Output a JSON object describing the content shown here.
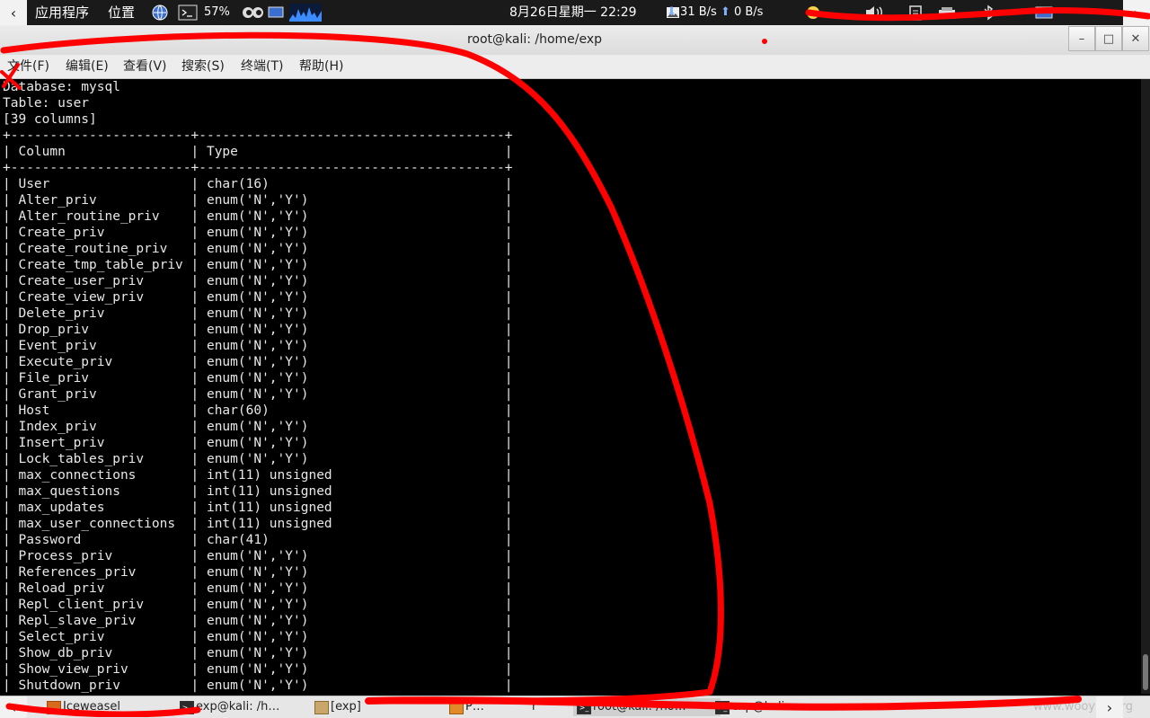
{
  "top_panel": {
    "apps_menu": "应用程序",
    "places_menu": "位置",
    "battery": "57%",
    "clock": "8月26日星期一 22:29",
    "net_down": "31 B/s",
    "net_up": "0 B/s"
  },
  "window": {
    "title": "root@kali: /home/exp",
    "minimize": "–",
    "maximize": "□",
    "close": "✕"
  },
  "menubar": {
    "file": "文件(F)",
    "edit": "编辑(E)",
    "view": "查看(V)",
    "search": "搜索(S)",
    "terminal": "终端(T)",
    "help": "帮助(H)"
  },
  "terminal": {
    "header_lines": [
      "Database: mysql",
      "Table: user",
      "[39 columns]"
    ],
    "border": "+-----------------------+---------------------------------------+",
    "col_headers": [
      "Column",
      "Type"
    ],
    "rows": [
      [
        "User",
        "char(16)"
      ],
      [
        "Alter_priv",
        "enum('N','Y')"
      ],
      [
        "Alter_routine_priv",
        "enum('N','Y')"
      ],
      [
        "Create_priv",
        "enum('N','Y')"
      ],
      [
        "Create_routine_priv",
        "enum('N','Y')"
      ],
      [
        "Create_tmp_table_priv",
        "enum('N','Y')"
      ],
      [
        "Create_user_priv",
        "enum('N','Y')"
      ],
      [
        "Create_view_priv",
        "enum('N','Y')"
      ],
      [
        "Delete_priv",
        "enum('N','Y')"
      ],
      [
        "Drop_priv",
        "enum('N','Y')"
      ],
      [
        "Event_priv",
        "enum('N','Y')"
      ],
      [
        "Execute_priv",
        "enum('N','Y')"
      ],
      [
        "File_priv",
        "enum('N','Y')"
      ],
      [
        "Grant_priv",
        "enum('N','Y')"
      ],
      [
        "Host",
        "char(60)"
      ],
      [
        "Index_priv",
        "enum('N','Y')"
      ],
      [
        "Insert_priv",
        "enum('N','Y')"
      ],
      [
        "Lock_tables_priv",
        "enum('N','Y')"
      ],
      [
        "max_connections",
        "int(11) unsigned"
      ],
      [
        "max_questions",
        "int(11) unsigned"
      ],
      [
        "max_updates",
        "int(11) unsigned"
      ],
      [
        "max_user_connections",
        "int(11) unsigned"
      ],
      [
        "Password",
        "char(41)"
      ],
      [
        "Process_priv",
        "enum('N','Y')"
      ],
      [
        "References_priv",
        "enum('N','Y')"
      ],
      [
        "Reload_priv",
        "enum('N','Y')"
      ],
      [
        "Repl_client_priv",
        "enum('N','Y')"
      ],
      [
        "Repl_slave_priv",
        "enum('N','Y')"
      ],
      [
        "Select_priv",
        "enum('N','Y')"
      ],
      [
        "Show_db_priv",
        "enum('N','Y')"
      ],
      [
        "Show_view_priv",
        "enum('N','Y')"
      ],
      [
        "Shutdown_priv",
        "enum('N','Y')"
      ]
    ]
  },
  "taskbar": {
    "tasks": [
      {
        "label": "Iceweasel",
        "active": false
      },
      {
        "label": "exp@kali: /h…",
        "active": false
      },
      {
        "label": "[exp]",
        "active": false
      },
      {
        "label": "P…",
        "active": false
      },
      {
        "label": "r",
        "active": false
      },
      {
        "label": "root@kali: /ho…",
        "active": true
      },
      {
        "label": "exp@kali: …",
        "active": false
      }
    ],
    "watermark": "www.wooyun.org"
  },
  "colors": {
    "annotation": "#ff0000",
    "terminal_bg": "#000000",
    "terminal_fg": "#e8e8e8"
  }
}
